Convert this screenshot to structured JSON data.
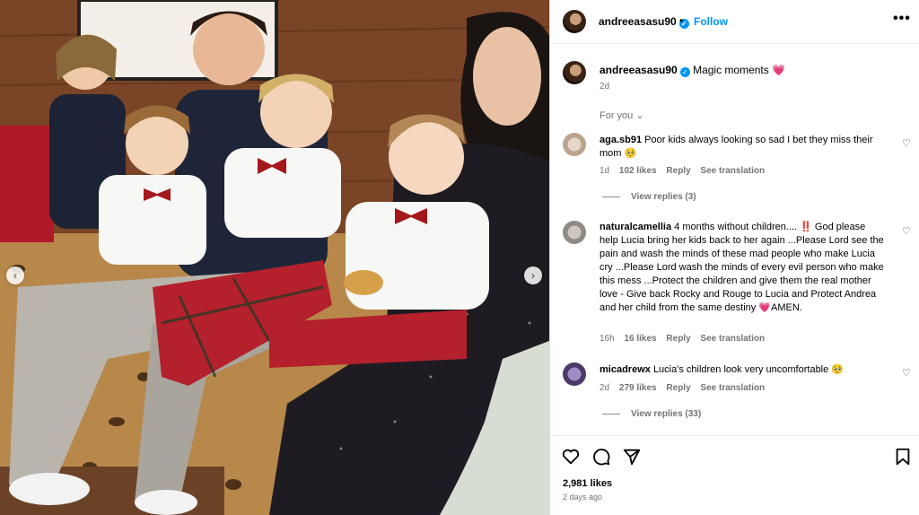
{
  "post": {
    "username": "andreeasasu90",
    "follow_label": "Follow",
    "more_label": "•••",
    "caption_text": "Magic moments",
    "caption_time": "2d",
    "feed_label": "For you",
    "likes": "2,981 likes",
    "posted": "2 days ago"
  },
  "comments": [
    {
      "username": "aga.sb91",
      "text": "Poor kids always looking so sad I bet they miss their mom 🥺",
      "time": "1d",
      "likes": "102 likes",
      "reply": "Reply",
      "translate": "See translation",
      "view_replies": "View replies (3)"
    },
    {
      "username": "naturalcamellia",
      "text": "4 months without children.... ‼️ God please help Lucia bring her kids back to her again ...Please Lord see the pain and wash the minds of these mad people who make Lucia cry ...Please Lord wash the minds of every evil person who make this mess ...Protect the children and give them the real mother love - Give back Rocky and Rouge to Lucia and Protect Andrea and her child from the same destiny 💗AMEN.",
      "time": "16h",
      "likes": "16 likes",
      "reply": "Reply",
      "translate": "See translation"
    },
    {
      "username": "micadrewx",
      "text": "Lucia's children look very uncomfortable 🥺",
      "time": "2d",
      "likes": "279 likes",
      "reply": "Reply",
      "translate": "See translation",
      "view_replies": "View replies (33)"
    }
  ],
  "icons": {
    "heart": "heart-icon",
    "comment": "comment-icon",
    "share": "share-icon",
    "save": "bookmark-icon",
    "more": "more-icon",
    "verified": "verified-badge-icon",
    "chevron": "chevron-down-icon",
    "prev": "chevron-left-icon",
    "next": "chevron-right-icon"
  },
  "colors": {
    "accent": "#0095f6",
    "muted": "#737373",
    "like": "#ed4956"
  }
}
